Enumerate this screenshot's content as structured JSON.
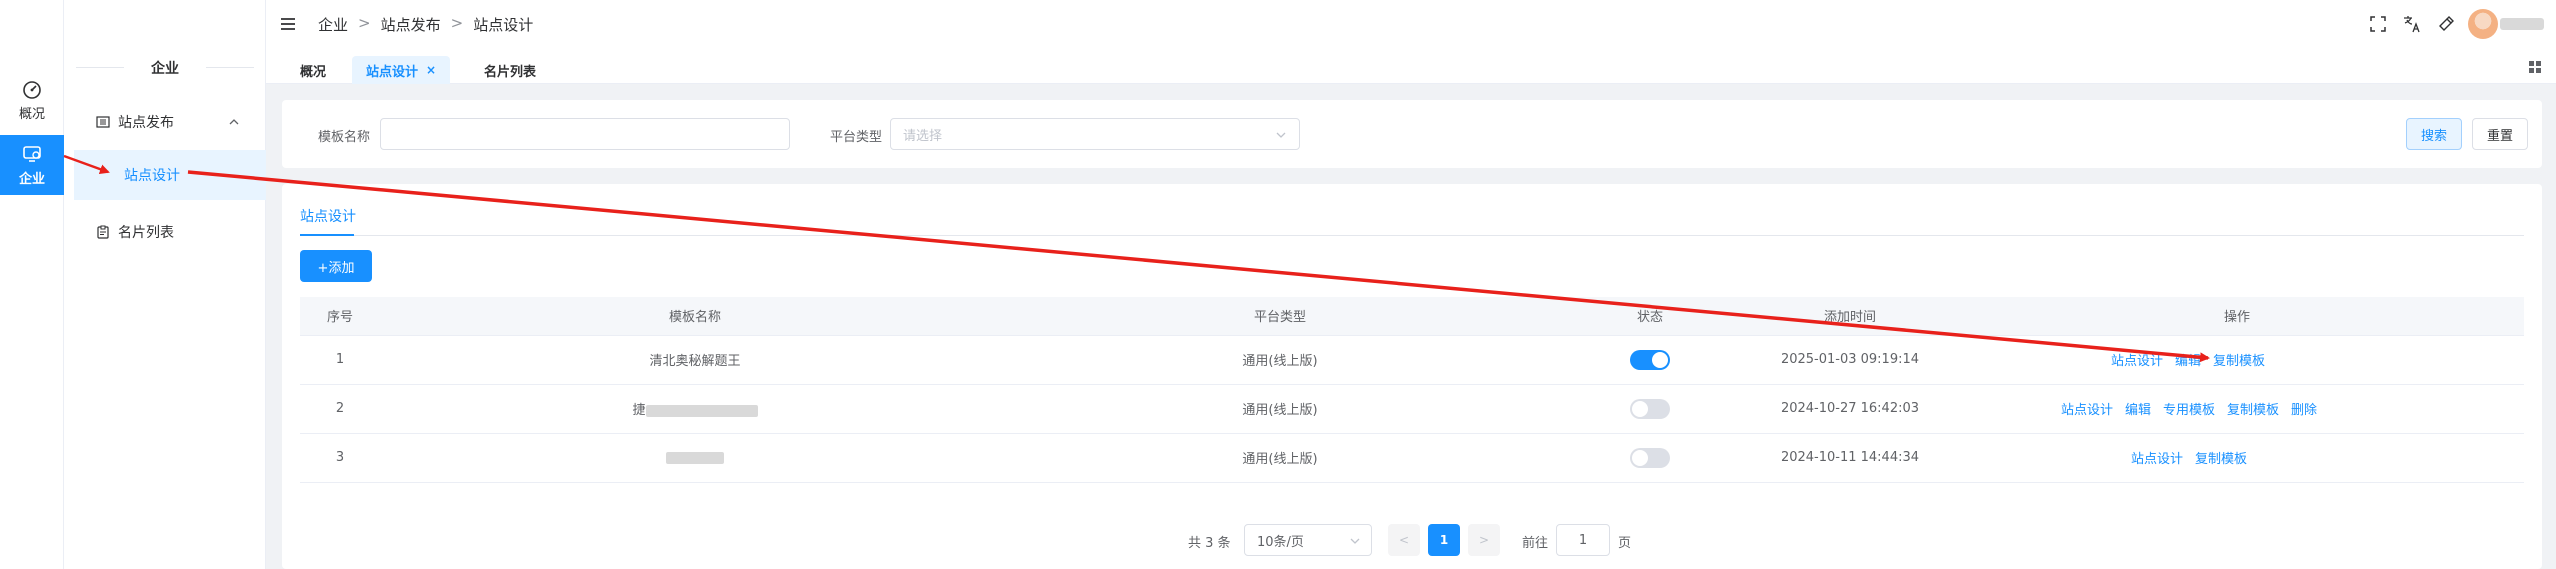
{
  "rail": {
    "items": [
      {
        "label": "概况",
        "icon": "dashboard-icon",
        "active": false
      },
      {
        "label": "企业",
        "icon": "monitor-icon",
        "active": true
      }
    ]
  },
  "sidebar": {
    "title": "企业",
    "group_label": "站点发布",
    "sub_active": "站点设计",
    "item_label": "名片列表"
  },
  "header": {
    "breadcrumb": [
      "企业",
      "站点发布",
      "站点设计"
    ],
    "breadcrumb_sep": ">",
    "icons": [
      "fullscreen-icon",
      "translate-icon",
      "theme-icon"
    ]
  },
  "tabs": {
    "items": [
      {
        "label": "概况",
        "active": false
      },
      {
        "label": "站点设计",
        "active": true,
        "closable": true
      },
      {
        "label": "名片列表",
        "active": false
      }
    ],
    "close_glyph": "×"
  },
  "search": {
    "template_name_label": "模板名称",
    "template_name_value": "",
    "platform_label": "平台类型",
    "platform_placeholder": "请选择",
    "search_btn": "搜索",
    "reset_btn": "重置"
  },
  "main": {
    "tab_label": "站点设计",
    "add_btn": "+添加",
    "columns": [
      "序号",
      "模板名称",
      "平台类型",
      "状态",
      "添加时间",
      "操作"
    ],
    "rows": [
      {
        "index": "1",
        "name": "清北奥秘解题王",
        "name_prefix": "",
        "platform": "通用(线上版)",
        "status_on": true,
        "time": "2025-01-03 09:19:14",
        "ops": [
          "站点设计",
          "编辑",
          "复制模板"
        ]
      },
      {
        "index": "2",
        "name": "",
        "name_prefix": "捷",
        "platform": "通用(线上版)",
        "status_on": false,
        "time": "2024-10-27 16:42:03",
        "ops": [
          "站点设计",
          "编辑",
          "专用模板",
          "复制模板",
          "删除"
        ]
      },
      {
        "index": "3",
        "name": "",
        "name_prefix": "",
        "platform": "通用(线上版)",
        "status_on": false,
        "time": "2024-10-11 14:44:34",
        "ops": [
          "站点设计",
          "复制模板"
        ]
      }
    ]
  },
  "pagination": {
    "total_text": "共 3 条",
    "page_size": "10条/页",
    "prev": "<",
    "current": "1",
    "next": ">",
    "jump_label": "前往",
    "jump_value": "1",
    "jump_suffix": "页"
  },
  "colors": {
    "primary": "#1890ff",
    "annotation": "#e8211b"
  }
}
